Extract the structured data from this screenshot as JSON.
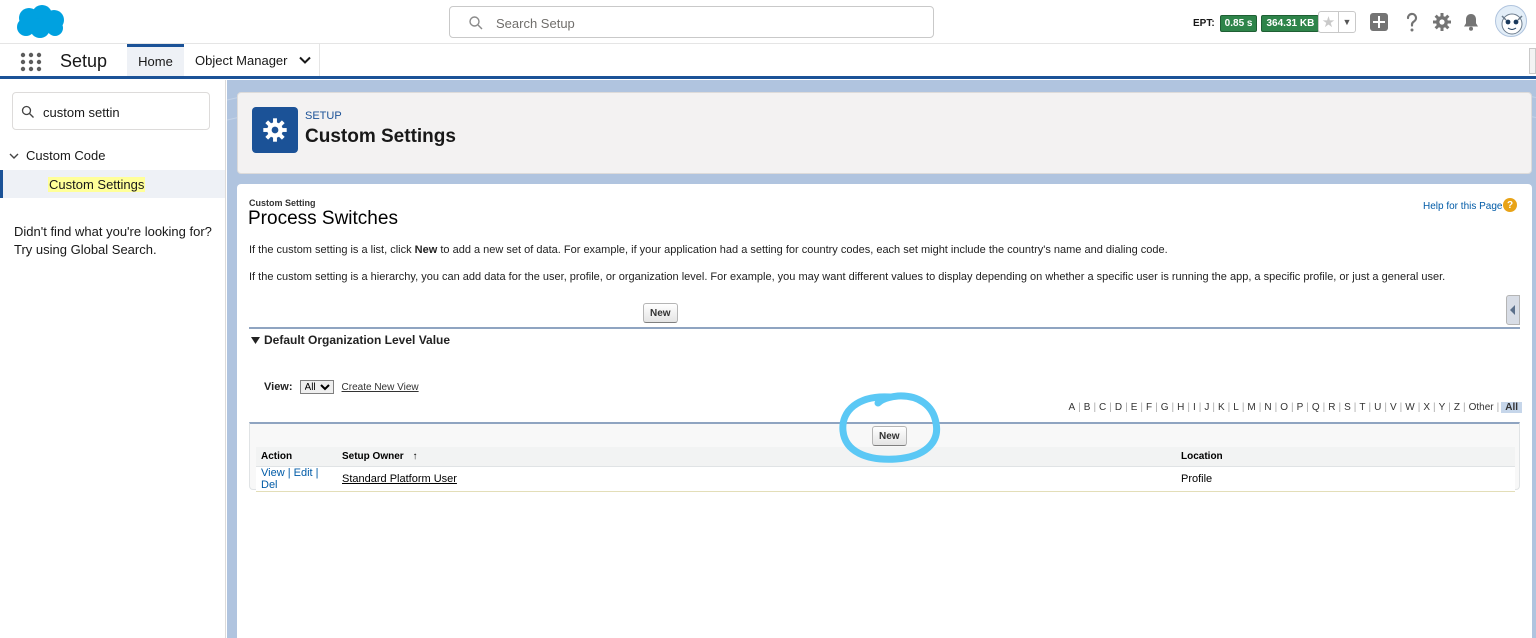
{
  "header": {
    "search_placeholder": "Search Setup",
    "ept_label": "EPT:",
    "ept_time": "0.85 s",
    "ept_size": "364.31 KB"
  },
  "nav": {
    "app_name": "Setup",
    "tabs": [
      {
        "label": "Home",
        "active": true
      },
      {
        "label": "Object Manager",
        "active": false
      }
    ]
  },
  "sidebar": {
    "quickfind_value": "custom settin",
    "node_label": "Custom Code",
    "leaf_label": "Custom Settings",
    "no_find_text": "Didn't find what you're looking for? Try using Global Search."
  },
  "page_header": {
    "eyebrow": "SETUP",
    "title": "Custom Settings"
  },
  "detail": {
    "type_label": "Custom Setting",
    "name": "Process Switches",
    "help_link": "Help for this Page",
    "para1_before": "If the custom setting is a list, click ",
    "para1_bold": "New",
    "para1_after": " to add a new set of data. For example, if your application had a setting for country codes, each set might include the country's name and dialing code.",
    "para2": "If the custom setting is a hierarchy, you can add data for the user, profile, or organization level. For example, you may want different values to display depending on whether a specific user is running the app, a specific profile, or just a general user.",
    "new_button": "New",
    "section_title": "Default Organization Level Value"
  },
  "list_view": {
    "view_label": "View:",
    "view_selected": "All",
    "create_view_link": "Create New View",
    "alphabet": [
      "A",
      "B",
      "C",
      "D",
      "E",
      "F",
      "G",
      "H",
      "I",
      "J",
      "K",
      "L",
      "M",
      "N",
      "O",
      "P",
      "Q",
      "R",
      "S",
      "T",
      "U",
      "V",
      "W",
      "X",
      "Y",
      "Z",
      "Other"
    ],
    "all_label": "All",
    "new_button": "New",
    "columns": {
      "action": "Action",
      "owner": "Setup Owner",
      "sort_indicator": "↑",
      "location": "Location"
    },
    "rows": [
      {
        "view": "View",
        "edit": "Edit",
        "del": "Del",
        "owner": "Standard Platform User",
        "location": "Profile"
      }
    ]
  },
  "colors": {
    "brand": "#1b5297",
    "ept_badge": "#2e844a",
    "annotation": "#5bc8f5"
  }
}
